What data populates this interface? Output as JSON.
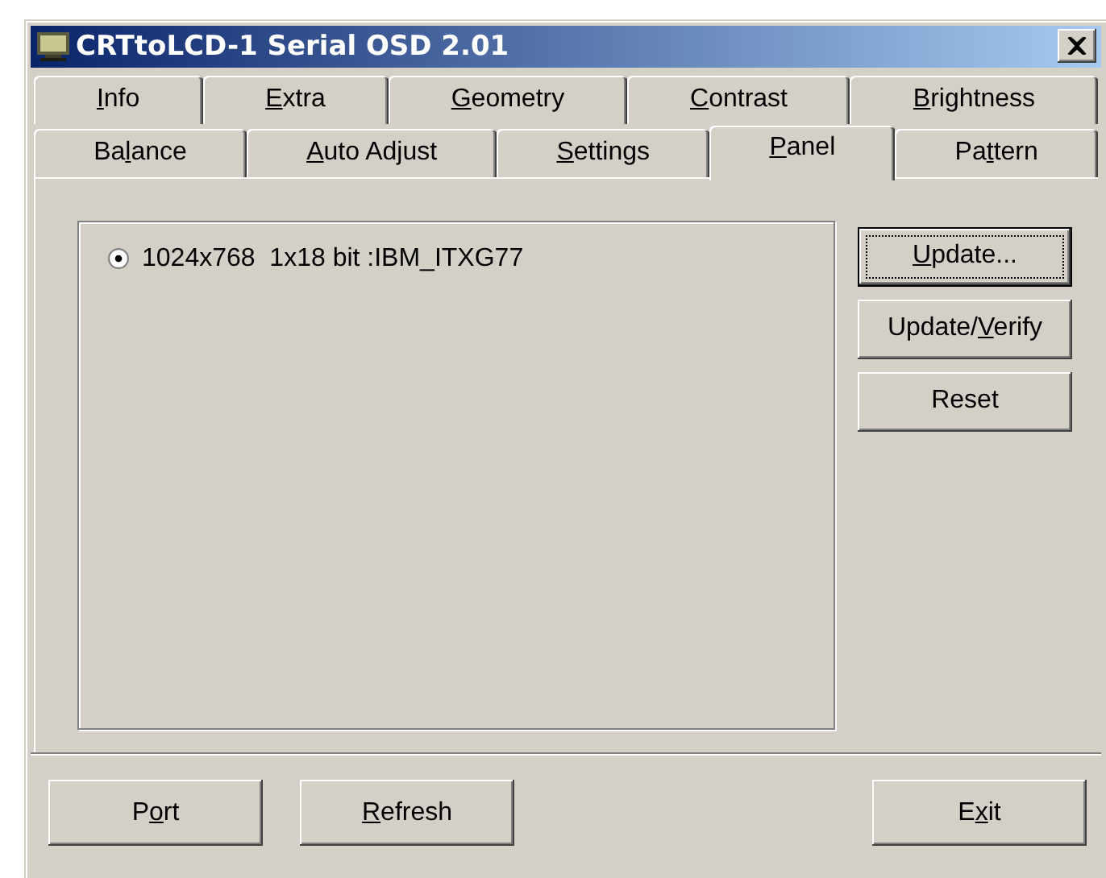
{
  "window": {
    "title": "CRTtoLCD-1 Serial OSD 2.01"
  },
  "tab_rows": [
    {
      "tabs": [
        {
          "label": [
            {
              "text": "I",
              "underlined": true
            },
            {
              "text": "nfo",
              "underlined": false
            }
          ],
          "selected": false
        },
        {
          "label": [
            {
              "text": "E",
              "underlined": true
            },
            {
              "text": "xtra",
              "underlined": false
            }
          ],
          "selected": false
        },
        {
          "label": [
            {
              "text": "G",
              "underlined": true
            },
            {
              "text": "eometry",
              "underlined": false
            }
          ],
          "selected": false
        },
        {
          "label": [
            {
              "text": "C",
              "underlined": true
            },
            {
              "text": "ontrast",
              "underlined": false
            }
          ],
          "selected": false
        },
        {
          "label": [
            {
              "text": "B",
              "underlined": true
            },
            {
              "text": "rightness",
              "underlined": false
            }
          ],
          "selected": false
        }
      ]
    },
    {
      "tabs": [
        {
          "label": [
            {
              "text": "Ba",
              "underlined": false
            },
            {
              "text": "l",
              "underlined": true
            },
            {
              "text": "ance",
              "underlined": false
            }
          ],
          "selected": false
        },
        {
          "label": [
            {
              "text": "A",
              "underlined": true
            },
            {
              "text": "uto Adjust",
              "underlined": false
            }
          ],
          "selected": false
        },
        {
          "label": [
            {
              "text": "S",
              "underlined": true
            },
            {
              "text": "ettings",
              "underlined": false
            }
          ],
          "selected": false
        },
        {
          "label": [
            {
              "text": "P",
              "underlined": true
            },
            {
              "text": "anel",
              "underlined": false
            }
          ],
          "selected": true
        },
        {
          "label": [
            {
              "text": "Pa",
              "underlined": false
            },
            {
              "text": "t",
              "underlined": true
            },
            {
              "text": "tern",
              "underlined": false
            }
          ],
          "selected": false
        }
      ]
    }
  ],
  "panel": {
    "options": [
      {
        "label": "1024x768  1x18 bit :IBM_ITXG77",
        "selected": true
      }
    ],
    "buttons": [
      {
        "label": [
          {
            "text": "U",
            "underlined": true
          },
          {
            "text": "pdate...",
            "underlined": false
          }
        ],
        "focused": true
      },
      {
        "label": [
          {
            "text": "Update/",
            "underlined": false
          },
          {
            "text": "V",
            "underlined": true
          },
          {
            "text": "erify",
            "underlined": false
          }
        ],
        "focused": false
      },
      {
        "label": [
          {
            "text": "Reset",
            "underlined": false
          }
        ],
        "focused": false
      }
    ]
  },
  "bottom_buttons": [
    {
      "label": [
        {
          "text": "P",
          "underlined": false
        },
        {
          "text": "o",
          "underlined": true
        },
        {
          "text": "rt",
          "underlined": false
        }
      ]
    },
    {
      "label": [
        {
          "text": "R",
          "underlined": true
        },
        {
          "text": "efresh",
          "underlined": false
        }
      ]
    },
    {
      "label": [
        {
          "text": "E",
          "underlined": false
        },
        {
          "text": "x",
          "underlined": true
        },
        {
          "text": "it",
          "underlined": false
        }
      ]
    }
  ]
}
